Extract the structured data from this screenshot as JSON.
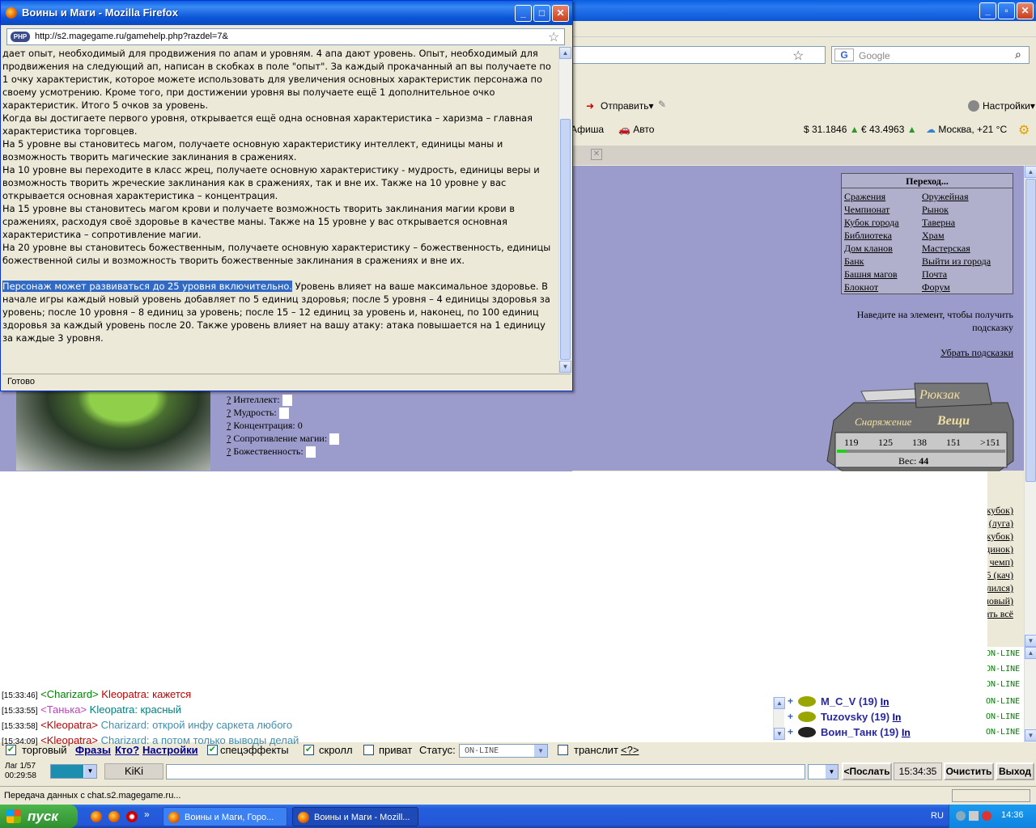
{
  "popup": {
    "title": "Воины и Маги - Mozilla Firefox",
    "url": "http://s2.magegame.ru/gamehelp.php?razdel=7&",
    "status": "Готово",
    "paragraphs": [
      "дает опыт, необходимый для продвижения по апам и уровням. 4 апа дают уровень. Опыт, необходимый для продвижения на следующий ап, написан в скобках в поле \"опыт\". За каждый прокачанный ап вы получаете по 1 очку характеристик, которое можете использовать для увеличения основных характеристик персонажа по своему усмотрению. Кроме того, при достижении уровня вы получаете ещё 1 дополнительное очко характеристик. Итого 5 очков за уровень.",
      "Когда вы достигаете первого уровня, открывается ещё одна основная характеристика – харизма – главная характеристика торговцев.",
      "На 5 уровне вы становитесь магом, получаете основную характеристику интеллект, единицы маны и возможность творить магические заклинания в сражениях.",
      "На 10 уровне вы переходите в класс жрец, получаете основную характеристику - мудрость, единицы веры и возможность творить жреческие заклинания как в сражениях, так и вне их. Также на 10 уровне у вас открывается основная характеристика – концентрация.",
      "На 15 уровне вы становитесь магом крови и получаете возможность творить заклинания магии крови в сражениях, расходуя своё здоровье в качестве маны. Также на 15 уровне у вас открывается основная характеристика – сопротивление магии.",
      "На 20 уровне вы становитесь божественным, получаете основную характеристику – божественность, единицы божественной силы и возможность творить божественные заклинания в сражениях и вне их."
    ],
    "selected": "Персонаж может развиваться до 25 уровня включительно.",
    "after": " Уровень влияет на ваше максимальное здоровье. В начале игры каждый новый уровень добавляет по 5 единиц здоровья; после 5 уровня – 4 единицы здоровья за уровень; после 10 уровня – 8 единиц за уровень; после 15 – 12 единиц за уровень и, наконец, по 100 единиц здоровья за каждый уровень после 20. Также уровень влияет на вашу атаку: атака повышается на 1 единицу за каждые 3 уровня."
  },
  "browser": {
    "search_placeholder": "Google",
    "send": "Отправить",
    "settings": "Настройки",
    "afisha": "Афиша",
    "auto": "Авто",
    "usd": "$ 31.1846",
    "eur": "€ 43.4963",
    "weather": "Москва, +21 °C"
  },
  "nav": {
    "title": "Переход...",
    "left": [
      "Сражения",
      "Чемпионат",
      "Кубок города",
      "Библиотека",
      "Дом кланов",
      "Банк",
      "Башня магов",
      "Блокнот"
    ],
    "right": [
      "Оружейная",
      "Рынок",
      "Таверна",
      "Храм",
      "Мастерская",
      "Выйти из города",
      "Почта",
      "Форум"
    ],
    "hint": "Наведите на элемент, чтобы получить подсказку",
    "hide_hints": "Убрать подсказки"
  },
  "stats": [
    {
      "label": "Интеллект:",
      "value": ""
    },
    {
      "label": "Мудрость:",
      "value": ""
    },
    {
      "label": "Концентрация:",
      "value": "0"
    },
    {
      "label": "Сопротивление магии:",
      "value": ""
    },
    {
      "label": "Божественность:",
      "value": ""
    }
  ],
  "inventory": {
    "backpack": "Рюкзак",
    "gear": "Снаряжение",
    "things": "Вещи",
    "scale": [
      "119",
      "125",
      "138",
      "151",
      ">151"
    ],
    "weight_label": "Вес:",
    "weight": "44",
    "weight_fill": 0.06
  },
  "side_links": [
    "кубок)",
    "(луга)",
    "кубок)",
    "динок)",
    "чемп)",
    "5 (кач)",
    "лился)",
    "ловый)",
    "ать всё"
  ],
  "chat": [
    {
      "ts": "[15:33:46]",
      "from": "<Charizard>",
      "from_color": "#008000",
      "msg": "Kleopatra: кажется",
      "msg_color": "#c00000"
    },
    {
      "ts": "[15:33:55]",
      "from": "<Танька>",
      "from_color": "#c040c0",
      "msg": "Kleopatra: красный",
      "msg_color": "#008080"
    },
    {
      "ts": "[15:33:58]",
      "from": "<Kleopatra>",
      "from_color": "#c00000",
      "msg": "Charizard: открой инфу саркета любого",
      "msg_color": "#4090b0"
    },
    {
      "ts": "[15:34:09]",
      "from": "<Kleopatra>",
      "from_color": "#c00000",
      "msg": "Charizard: а потом только выводы делай",
      "msg_color": "#4090b0"
    }
  ],
  "players": [
    {
      "name": "M_C_V",
      "level": "(19)",
      "link": "In",
      "status": "ON-LINE"
    },
    {
      "name": "Tuzovsky",
      "level": "(19)",
      "link": "In",
      "status": "ON-LINE"
    },
    {
      "name": "Воин_Танк",
      "level": "(19)",
      "link": "In",
      "status": "ON-LINE"
    }
  ],
  "online_extra": [
    "ON-LINE",
    "ON-LINE",
    "ON-LINE"
  ],
  "controls": {
    "trade": "торговый",
    "phrases": "Фразы",
    "who": "Кто?",
    "settings": "Настройки",
    "effects": "спецэффекты",
    "scroll": "скролл",
    "private": "приват",
    "status_label": "Статус:",
    "status_value": "ON-LINE",
    "translit": "транслит",
    "translit_q": "<?>",
    "lag": "Лаг 1/57",
    "time": "00:29:58",
    "nick": "KiKi",
    "send": "<Послать",
    "clock": "15:34:35",
    "clear": "Очистить",
    "exit": "Выход"
  },
  "status_bar": "Передача данных с chat.s2.magegame.ru...",
  "taskbar": {
    "start": "пуск",
    "tasks": [
      "Воины и Маги, Горо...",
      "Воины и Маги - Mozill..."
    ],
    "lang": "RU",
    "time": "14:36"
  },
  "colors": {
    "lilac": "#9c9ccc",
    "xp_blue": "#245edc",
    "selection": "#316ac5"
  }
}
